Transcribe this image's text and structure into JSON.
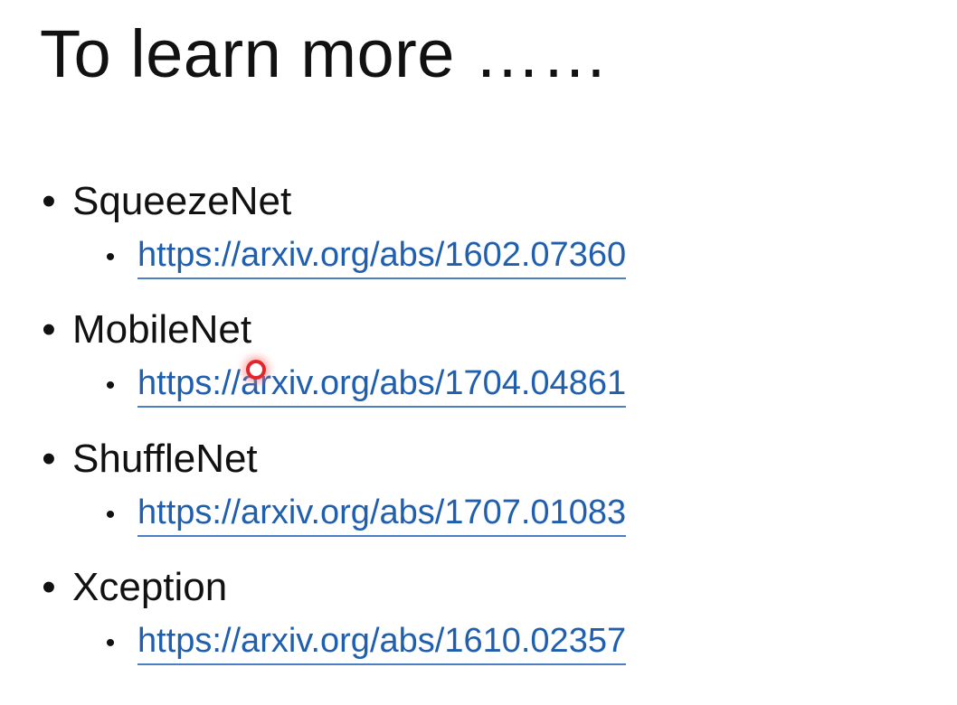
{
  "slide": {
    "title": "To learn more ……",
    "items": [
      {
        "label": "SqueezeNet",
        "link": "https://arxiv.org/abs/1602.07360"
      },
      {
        "label": "MobileNet",
        "link": "https://arxiv.org/abs/1704.04861"
      },
      {
        "label": "ShuffleNet",
        "link": "https://arxiv.org/abs/1707.01083"
      },
      {
        "label": "Xception",
        "link": "https://arxiv.org/abs/1610.02357"
      }
    ]
  },
  "colors": {
    "link": "#1f5fae",
    "text": "#111111",
    "pointer": "#e0262a"
  },
  "icons": {
    "bullet": "bullet-dot-icon",
    "pointer": "laser-pointer-icon"
  }
}
